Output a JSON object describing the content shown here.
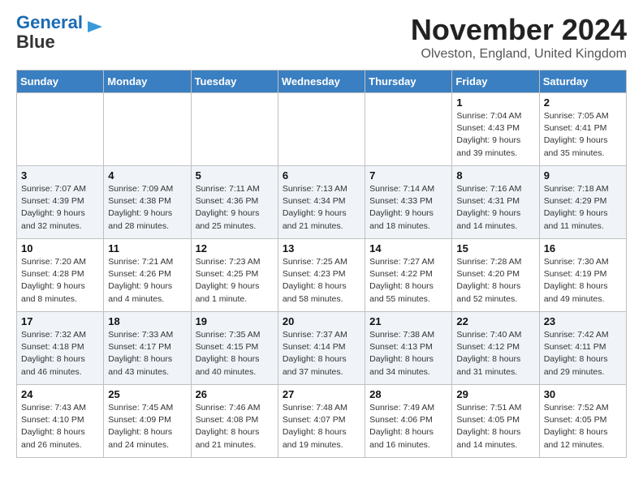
{
  "logo": {
    "line1": "General",
    "line2": "Blue"
  },
  "header": {
    "title": "November 2024",
    "subtitle": "Olveston, England, United Kingdom"
  },
  "weekdays": [
    "Sunday",
    "Monday",
    "Tuesday",
    "Wednesday",
    "Thursday",
    "Friday",
    "Saturday"
  ],
  "weeks": [
    [
      {
        "day": "",
        "info": ""
      },
      {
        "day": "",
        "info": ""
      },
      {
        "day": "",
        "info": ""
      },
      {
        "day": "",
        "info": ""
      },
      {
        "day": "",
        "info": ""
      },
      {
        "day": "1",
        "info": "Sunrise: 7:04 AM\nSunset: 4:43 PM\nDaylight: 9 hours\nand 39 minutes."
      },
      {
        "day": "2",
        "info": "Sunrise: 7:05 AM\nSunset: 4:41 PM\nDaylight: 9 hours\nand 35 minutes."
      }
    ],
    [
      {
        "day": "3",
        "info": "Sunrise: 7:07 AM\nSunset: 4:39 PM\nDaylight: 9 hours\nand 32 minutes."
      },
      {
        "day": "4",
        "info": "Sunrise: 7:09 AM\nSunset: 4:38 PM\nDaylight: 9 hours\nand 28 minutes."
      },
      {
        "day": "5",
        "info": "Sunrise: 7:11 AM\nSunset: 4:36 PM\nDaylight: 9 hours\nand 25 minutes."
      },
      {
        "day": "6",
        "info": "Sunrise: 7:13 AM\nSunset: 4:34 PM\nDaylight: 9 hours\nand 21 minutes."
      },
      {
        "day": "7",
        "info": "Sunrise: 7:14 AM\nSunset: 4:33 PM\nDaylight: 9 hours\nand 18 minutes."
      },
      {
        "day": "8",
        "info": "Sunrise: 7:16 AM\nSunset: 4:31 PM\nDaylight: 9 hours\nand 14 minutes."
      },
      {
        "day": "9",
        "info": "Sunrise: 7:18 AM\nSunset: 4:29 PM\nDaylight: 9 hours\nand 11 minutes."
      }
    ],
    [
      {
        "day": "10",
        "info": "Sunrise: 7:20 AM\nSunset: 4:28 PM\nDaylight: 9 hours\nand 8 minutes."
      },
      {
        "day": "11",
        "info": "Sunrise: 7:21 AM\nSunset: 4:26 PM\nDaylight: 9 hours\nand 4 minutes."
      },
      {
        "day": "12",
        "info": "Sunrise: 7:23 AM\nSunset: 4:25 PM\nDaylight: 9 hours\nand 1 minute."
      },
      {
        "day": "13",
        "info": "Sunrise: 7:25 AM\nSunset: 4:23 PM\nDaylight: 8 hours\nand 58 minutes."
      },
      {
        "day": "14",
        "info": "Sunrise: 7:27 AM\nSunset: 4:22 PM\nDaylight: 8 hours\nand 55 minutes."
      },
      {
        "day": "15",
        "info": "Sunrise: 7:28 AM\nSunset: 4:20 PM\nDaylight: 8 hours\nand 52 minutes."
      },
      {
        "day": "16",
        "info": "Sunrise: 7:30 AM\nSunset: 4:19 PM\nDaylight: 8 hours\nand 49 minutes."
      }
    ],
    [
      {
        "day": "17",
        "info": "Sunrise: 7:32 AM\nSunset: 4:18 PM\nDaylight: 8 hours\nand 46 minutes."
      },
      {
        "day": "18",
        "info": "Sunrise: 7:33 AM\nSunset: 4:17 PM\nDaylight: 8 hours\nand 43 minutes."
      },
      {
        "day": "19",
        "info": "Sunrise: 7:35 AM\nSunset: 4:15 PM\nDaylight: 8 hours\nand 40 minutes."
      },
      {
        "day": "20",
        "info": "Sunrise: 7:37 AM\nSunset: 4:14 PM\nDaylight: 8 hours\nand 37 minutes."
      },
      {
        "day": "21",
        "info": "Sunrise: 7:38 AM\nSunset: 4:13 PM\nDaylight: 8 hours\nand 34 minutes."
      },
      {
        "day": "22",
        "info": "Sunrise: 7:40 AM\nSunset: 4:12 PM\nDaylight: 8 hours\nand 31 minutes."
      },
      {
        "day": "23",
        "info": "Sunrise: 7:42 AM\nSunset: 4:11 PM\nDaylight: 8 hours\nand 29 minutes."
      }
    ],
    [
      {
        "day": "24",
        "info": "Sunrise: 7:43 AM\nSunset: 4:10 PM\nDaylight: 8 hours\nand 26 minutes."
      },
      {
        "day": "25",
        "info": "Sunrise: 7:45 AM\nSunset: 4:09 PM\nDaylight: 8 hours\nand 24 minutes."
      },
      {
        "day": "26",
        "info": "Sunrise: 7:46 AM\nSunset: 4:08 PM\nDaylight: 8 hours\nand 21 minutes."
      },
      {
        "day": "27",
        "info": "Sunrise: 7:48 AM\nSunset: 4:07 PM\nDaylight: 8 hours\nand 19 minutes."
      },
      {
        "day": "28",
        "info": "Sunrise: 7:49 AM\nSunset: 4:06 PM\nDaylight: 8 hours\nand 16 minutes."
      },
      {
        "day": "29",
        "info": "Sunrise: 7:51 AM\nSunset: 4:05 PM\nDaylight: 8 hours\nand 14 minutes."
      },
      {
        "day": "30",
        "info": "Sunrise: 7:52 AM\nSunset: 4:05 PM\nDaylight: 8 hours\nand 12 minutes."
      }
    ]
  ]
}
